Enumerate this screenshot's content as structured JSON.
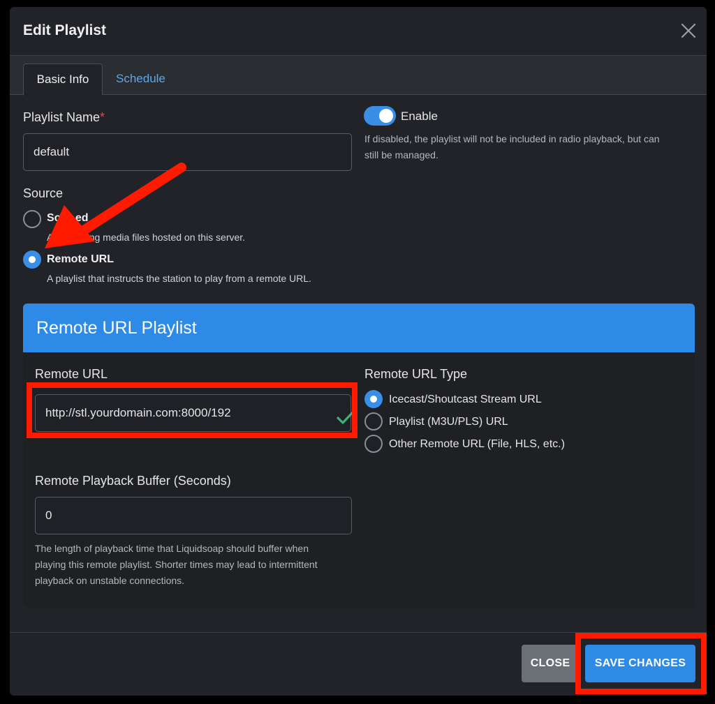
{
  "modal": {
    "title": "Edit Playlist",
    "close_icon": "close-icon"
  },
  "tabs": [
    {
      "label": "Basic Info",
      "active": true
    },
    {
      "label": "Schedule",
      "active": false
    }
  ],
  "form": {
    "name_label": "Playlist Name",
    "name_required": "*",
    "name_value": "default",
    "enable_label": "Enable",
    "enable_on": true,
    "enable_help_1": "If disabled, the playlist will not be included in radio playback, but can",
    "enable_help_2": "still be managed.",
    "source_label": "Source",
    "source_options": [
      {
        "title": "Song-Based",
        "visible_title": "So   R  ed",
        "desc": "A  containing media files hosted on this server.",
        "checked": false
      },
      {
        "title": "Remote URL",
        "desc": "A playlist that instructs the station to play from a remote URL.",
        "checked": true
      }
    ]
  },
  "remote_panel": {
    "title": "Remote URL Playlist",
    "url_label": "Remote URL",
    "url_value": "http://stl.yourdomain.com:8000/192",
    "valid_icon": "checkmark-icon",
    "type_label": "Remote URL Type",
    "type_options": [
      {
        "label": "Icecast/Shoutcast Stream URL",
        "checked": true
      },
      {
        "label": "Playlist (M3U/PLS) URL",
        "checked": false
      },
      {
        "label": "Other Remote URL (File, HLS, etc.)",
        "checked": false
      }
    ],
    "buffer_label": "Remote Playback Buffer (Seconds)",
    "buffer_value": "0",
    "buffer_help_1": "The length of playback time that Liquidsoap should buffer when",
    "buffer_help_2": "playing this remote playlist. Shorter times may lead to intermittent",
    "buffer_help_3": "playback on unstable connections."
  },
  "footer": {
    "close_label": "CLOSE",
    "save_label": "SAVE CHANGES"
  },
  "annotations": {
    "color": "#ff1a00",
    "arrow_icon": "arrow-annotation-icon"
  },
  "colors": {
    "accent": "#2d8ae6",
    "background": "#212329",
    "annotation": "#ff1a00"
  }
}
